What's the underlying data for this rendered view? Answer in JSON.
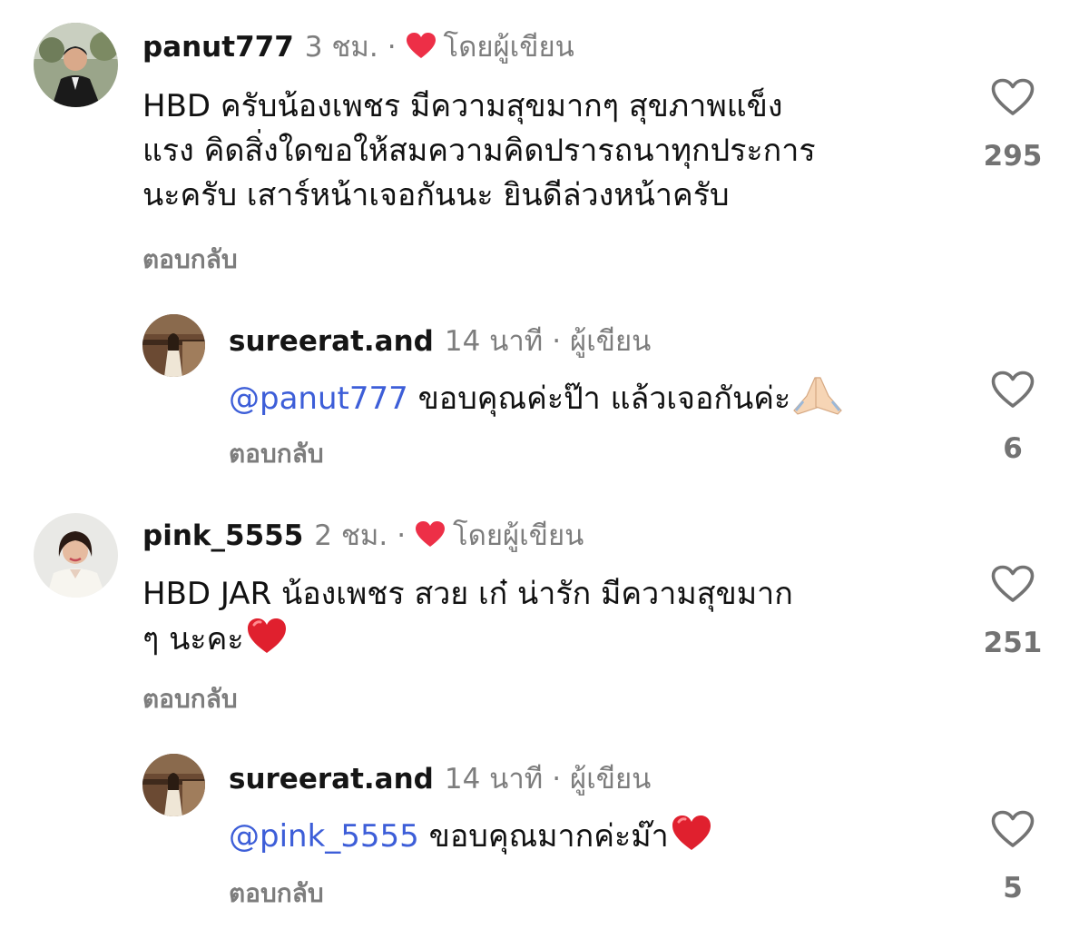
{
  "comments": [
    {
      "username": "panut777",
      "time": "3 ชม.",
      "dot": "·",
      "author_tag": "โดยผู้เขียน",
      "text_lines": [
        "HBD ครับน้องเพชร มีความสุขมากๆ สุขภาพแข็ง",
        "แรง คิดสิ่งใดขอให้สมความคิดปรารถนาทุกประการ",
        "นะครับ เสาร์หน้าเจอกันนะ ยินดีล่วงหน้าครับ"
      ],
      "reply_label": "ตอบกลับ",
      "likes": "295",
      "liked_by_author_color": "#ed2f47"
    },
    {
      "username": "sureerat.and",
      "time": "14 นาที",
      "dot": "·",
      "author_tag": "ผู้เขียน",
      "mention": "@panut777",
      "text": "ขอบคุณค่ะป๊า แล้วเจอกันค่ะ",
      "emoji": "folded-hands-emoji",
      "reply_label": "ตอบกลับ",
      "likes": "6"
    },
    {
      "username": "pink_5555",
      "time": "2 ชม.",
      "dot": "·",
      "author_tag": "โดยผู้เขียน",
      "text_lines": [
        "HBD JAR น้องเพชร สวย เก๋ น่ารัก  มีความสุขมาก",
        "ๆ นะคะ"
      ],
      "emoji": "red-heart-emoji",
      "reply_label": "ตอบกลับ",
      "likes": "251"
    },
    {
      "username": "sureerat.and",
      "time": "14 นาที",
      "dot": "·",
      "author_tag": "ผู้เขียน",
      "mention": "@pink_5555",
      "text": "ขอบคุณมากค่ะม๊า",
      "emoji": "red-heart-emoji",
      "reply_label": "ตอบกลับ",
      "likes": "5"
    }
  ],
  "colors": {
    "mention": "#3d5ed8",
    "meta": "#7d7d7d",
    "heart": "#ed2f47"
  }
}
